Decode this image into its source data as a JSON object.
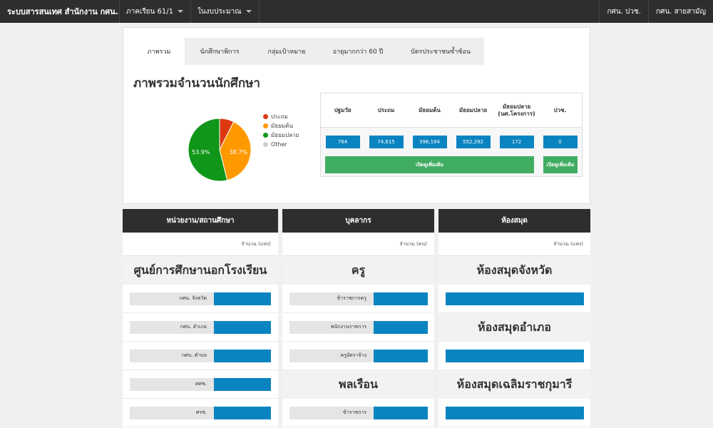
{
  "navbar": {
    "brand": "ระบบสารสนเทศ สำนักงาน กศน.",
    "term": "ภาคเรียน 61/1",
    "budget": "ในงบประมาณ",
    "right": [
      "กศน. ปวช.",
      "กศน. สายสามัญ"
    ]
  },
  "tabs": [
    "ภาพรวม",
    "นักศึกษาพิการ",
    "กลุ่มเป้าหมาย",
    "อายุมากกว่า 60 ปี",
    "บัตรประชาชนซ้ำซ้อน"
  ],
  "overview": {
    "title": "ภาพรวมจำนวนนักศึกษา",
    "stat_headers": [
      "ปฐมวัย",
      "ประถม",
      "มัธยมต้น",
      "มัธยมปลาย",
      "มัธยมปลาย (นศ.โครงการ)",
      "ปวช."
    ],
    "stat_values": [
      "764",
      "74,615",
      "396,194",
      "552,292",
      "172",
      "0"
    ],
    "more_label": "เปิดดูเพิ่มเติม"
  },
  "chart_data": {
    "type": "pie",
    "title": "",
    "slices": [
      {
        "name": "ประถม",
        "percent": 7.4,
        "color": "#dc3912",
        "label": ""
      },
      {
        "name": "มัธยมต้น",
        "percent": 38.7,
        "color": "#ff9900",
        "label": "38.7%"
      },
      {
        "name": "มัธยมปลาย",
        "percent": 53.9,
        "color": "#109618",
        "label": "53.9%"
      },
      {
        "name": "Other",
        "percent": 0,
        "color": "#cccccc",
        "label": ""
      }
    ],
    "legend_position": "right"
  },
  "panels": {
    "units": {
      "title": "หน่วยงาน/สถานศึกษา",
      "unit": "จำนวน (แห่ง)",
      "section": "ศูนย์การศึกษานอกโรงเรียน",
      "rows": [
        "กศน. จังหวัด",
        "กศน. อำเภอ",
        "กศน. ตำบล",
        "ศศช.",
        "ศรช."
      ]
    },
    "staff": {
      "title": "บุคลากร",
      "unit": "จำนวน (คน)",
      "section1": "ครู",
      "rows1": [
        "ข้าราชการครู",
        "พนักงานราชการ",
        "ครูอัตราจ้าง"
      ],
      "section2": "พลเรือน",
      "rows2": [
        "ข้าราชการ"
      ]
    },
    "library": {
      "title": "ห้องสมุด",
      "unit": "จำนวน (แห่ง)",
      "sections": [
        "ห้องสมุดจังหวัด",
        "ห้องสมุดอำเภอ",
        "ห้องสมุดเฉลิมราชกุมารี"
      ]
    }
  },
  "colors": {
    "navbar": "#2e2e2e",
    "accent_blue": "#0a84c1",
    "accent_green": "#41ad62"
  }
}
